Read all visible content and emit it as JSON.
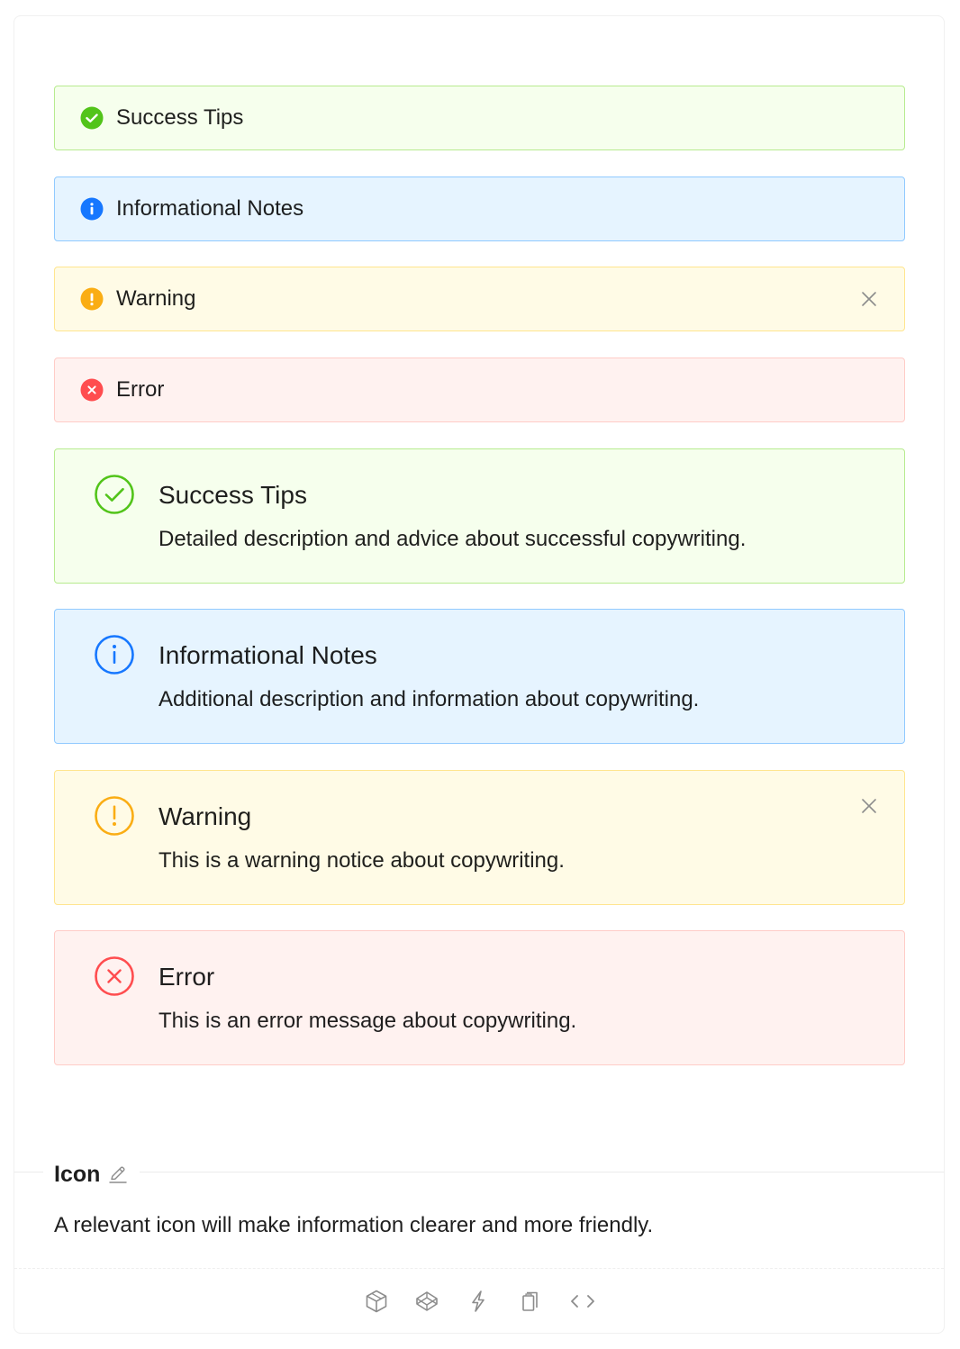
{
  "alerts_small": [
    {
      "type": "success",
      "message": "Success Tips",
      "icon": "check-circle-filled-icon"
    },
    {
      "type": "info",
      "message": "Informational Notes",
      "icon": "info-circle-filled-icon"
    },
    {
      "type": "warning",
      "message": "Warning",
      "icon": "exclamation-circle-filled-icon",
      "closable": true
    },
    {
      "type": "error",
      "message": "Error",
      "icon": "close-circle-filled-icon"
    }
  ],
  "alerts_big": [
    {
      "type": "success",
      "message": "Success Tips",
      "description": "Detailed description and advice about successful copywriting.",
      "icon": "check-circle-outline-icon"
    },
    {
      "type": "info",
      "message": "Informational Notes",
      "description": "Additional description and information about copywriting.",
      "icon": "info-circle-outline-icon"
    },
    {
      "type": "warning",
      "message": "Warning",
      "description": "This is a warning notice about copywriting.",
      "icon": "exclamation-circle-outline-icon",
      "closable": true
    },
    {
      "type": "error",
      "message": "Error",
      "description": "This is an error message about copywriting.",
      "icon": "close-circle-outline-icon"
    }
  ],
  "demo_meta": {
    "title": "Icon",
    "description": "A relevant icon will make information clearer and more friendly."
  },
  "actions": [
    "codesandbox-icon",
    "codepen-icon",
    "stackblitz-icon",
    "copy-icon",
    "code-expand-icon"
  ],
  "colors": {
    "success": "#52c41a",
    "info": "#1677ff",
    "warning": "#faad14",
    "error": "#ff4d4f"
  }
}
